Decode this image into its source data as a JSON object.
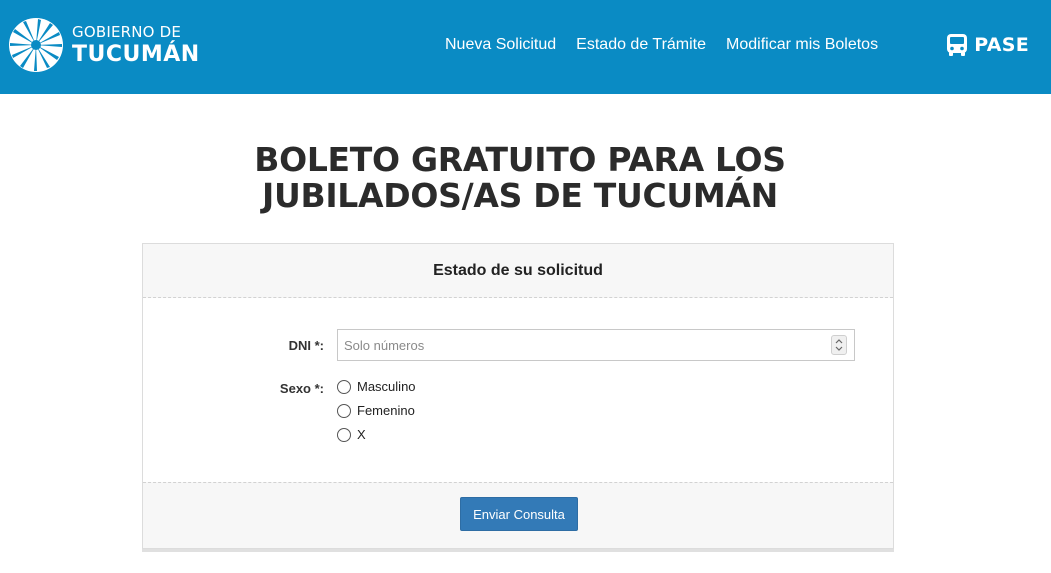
{
  "header": {
    "logo": {
      "line1": "GOBIERNO DE",
      "line2": "TUCUMÁN"
    },
    "nav": [
      {
        "label": "Nueva Solicitud"
      },
      {
        "label": "Estado de Trámite"
      },
      {
        "label": "Modificar mis Boletos"
      }
    ],
    "brand": {
      "label": "PASE",
      "icon": "bus-icon"
    },
    "background_color": "#0a8bc4"
  },
  "page": {
    "title_line1": "BOLETO GRATUITO PARA LOS",
    "title_line2": "JUBILADOS/AS DE TUCUMÁN"
  },
  "form": {
    "heading": "Estado de su solicitud",
    "dni": {
      "label": "DNI *:",
      "placeholder": "Solo números",
      "value": ""
    },
    "sexo": {
      "label": "Sexo *:",
      "options": [
        {
          "label": "Masculino",
          "selected": false
        },
        {
          "label": "Femenino",
          "selected": false
        },
        {
          "label": "X",
          "selected": false
        }
      ]
    },
    "submit_label": "Enviar Consulta",
    "submit_color": "#337ab7"
  }
}
